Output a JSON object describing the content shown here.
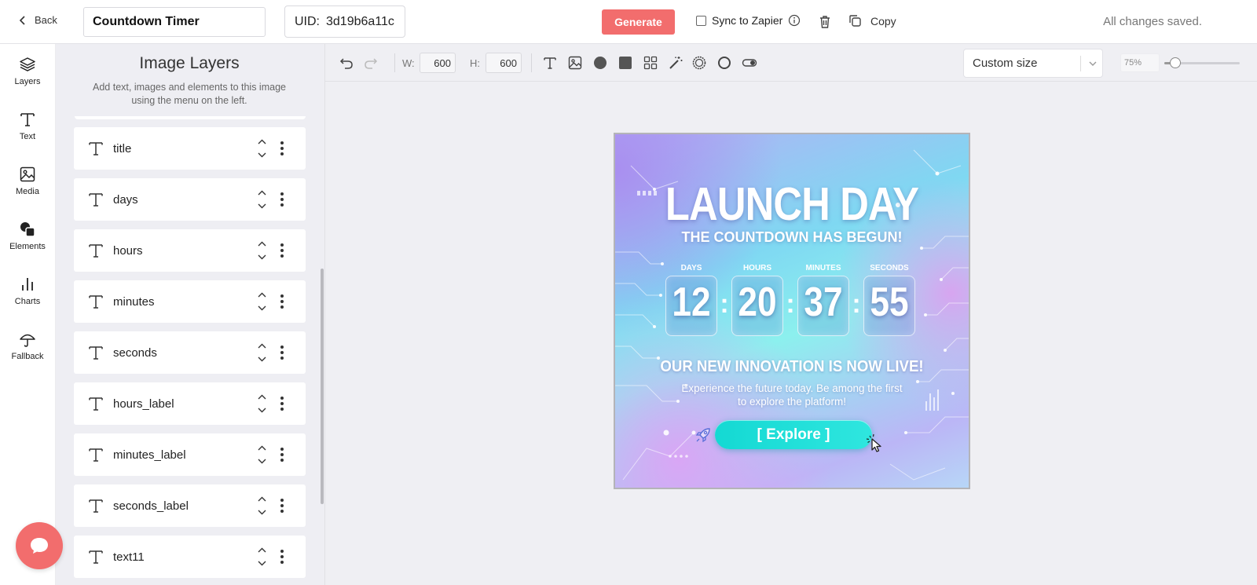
{
  "header": {
    "back_label": "Back",
    "template_name": "Countdown Timer",
    "uid_label": "UID:",
    "uid_value": "3d19b6a11c",
    "generate_label": "Generate",
    "sync_label": "Sync to Zapier",
    "copy_label": "Copy",
    "status_text": "All changes saved."
  },
  "rail": {
    "items": [
      {
        "label": "Layers",
        "icon": "layers-icon"
      },
      {
        "label": "Text",
        "icon": "text-icon"
      },
      {
        "label": "Media",
        "icon": "image-icon"
      },
      {
        "label": "Elements",
        "icon": "shapes-icon"
      },
      {
        "label": "Charts",
        "icon": "bar-chart-icon"
      },
      {
        "label": "Fallback",
        "icon": "umbrella-icon"
      }
    ]
  },
  "panel": {
    "title": "Image Layers",
    "subtitle": "Add text, images and elements to this image using the menu on the left.",
    "layers": [
      "title",
      "days",
      "hours",
      "minutes",
      "seconds",
      "hours_label",
      "minutes_label",
      "seconds_label",
      "text11"
    ]
  },
  "toolbar": {
    "w_label": "W:",
    "w_value": "600",
    "h_label": "H:",
    "h_value": "600",
    "size_preset": "Custom size",
    "zoom_value": "75%",
    "zoom_fraction": 0.15
  },
  "design": {
    "title": "LAUNCH DAY",
    "subtitle": "THE COUNTDOWN HAS BEGUN!",
    "labels": {
      "days": "DAYS",
      "hours": "HOURS",
      "minutes": "MINUTES",
      "seconds": "SECONDS"
    },
    "values": {
      "days": "12",
      "hours": "20",
      "minutes": "37",
      "seconds": "55"
    },
    "separator": ":",
    "headline": "OUR NEW INNOVATION IS NOW LIVE!",
    "body": "Experience the future today. Be among the first to explore the platform!",
    "button_label": "[ Explore ]"
  },
  "colors": {
    "accent": "#f26d6d",
    "button": "#1fdbd5"
  }
}
